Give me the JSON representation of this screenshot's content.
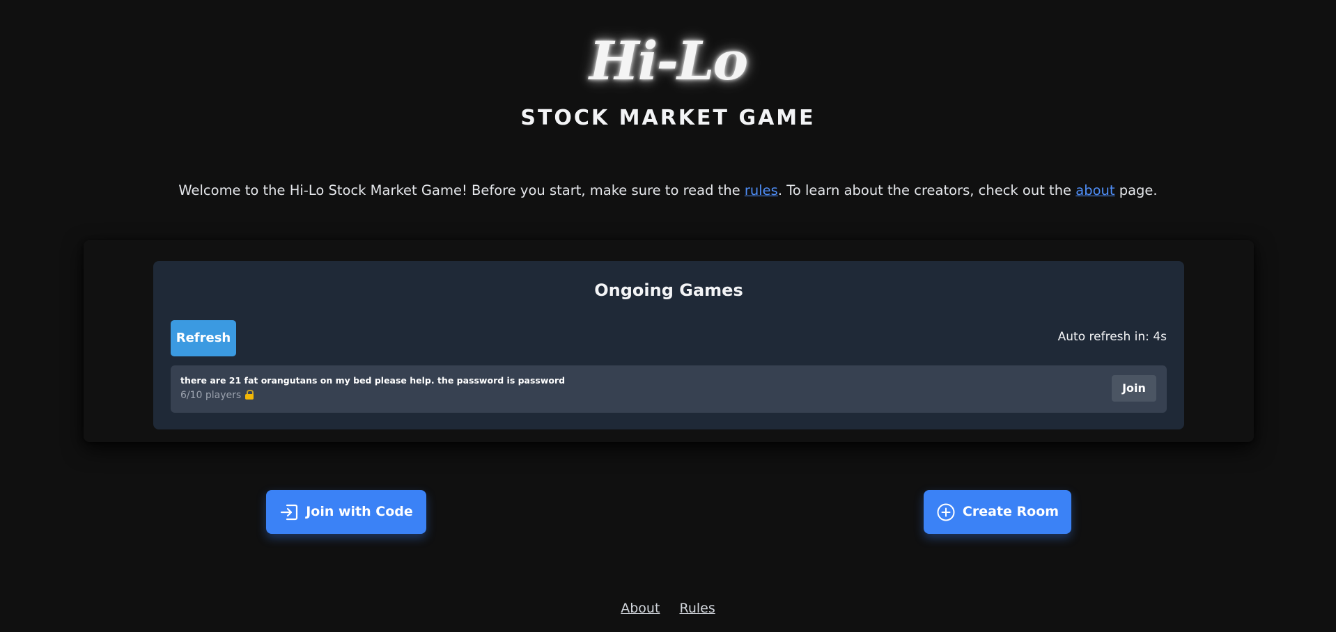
{
  "header": {
    "logo": "Hi-Lo",
    "subtitle": "STOCK MARKET GAME"
  },
  "welcome": {
    "before_rules": "Welcome to the Hi-Lo Stock Market Game! Before you start, make sure to read the ",
    "rules_link": "rules",
    "middle": ". To learn about the creators, check out the ",
    "about_link": "about",
    "after": " page."
  },
  "games": {
    "title": "Ongoing Games",
    "refresh_label": "Refresh",
    "auto_refresh": "Auto refresh in: 4s",
    "rows": [
      {
        "name": "there are 21 fat orangutans on my bed please help. the password is password",
        "players": "6/10 players",
        "locked_icon": "lock-icon",
        "join_label": "Join"
      }
    ]
  },
  "actions": {
    "join_code_label": "Join with Code",
    "join_code_icon": "login-icon",
    "create_room_label": "Create Room",
    "create_room_icon": "plus-circle-icon"
  },
  "footer": {
    "about": "About",
    "rules": "Rules"
  },
  "colors": {
    "background": "#101010",
    "panel": "#1f2937",
    "row": "#374151",
    "accent": "#3b82f6",
    "refresh": "#3b9ae1",
    "link": "#4f8ef7"
  }
}
